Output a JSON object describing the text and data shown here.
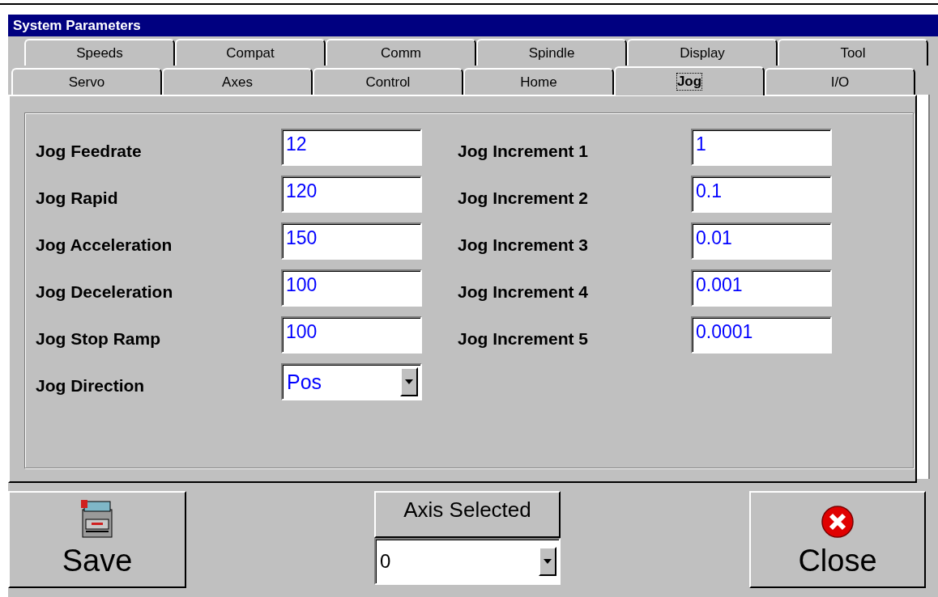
{
  "window": {
    "title": "System Parameters"
  },
  "tab_rows": [
    [
      {
        "label": "Speeds",
        "selected": false
      },
      {
        "label": "Compat",
        "selected": false
      },
      {
        "label": "Comm",
        "selected": false
      },
      {
        "label": "Spindle",
        "selected": false
      },
      {
        "label": "Display",
        "selected": false
      },
      {
        "label": "Tool",
        "selected": false
      }
    ],
    [
      {
        "label": "Servo",
        "selected": false
      },
      {
        "label": "Axes",
        "selected": false
      },
      {
        "label": "Control",
        "selected": false
      },
      {
        "label": "Home",
        "selected": false
      },
      {
        "label": "Jog",
        "selected": true
      },
      {
        "label": "I/O",
        "selected": false
      }
    ]
  ],
  "left_fields": [
    {
      "kind": "text",
      "label": "Jog Feedrate",
      "value": "12"
    },
    {
      "kind": "text",
      "label": "Jog Rapid",
      "value": "120"
    },
    {
      "kind": "text",
      "label": "Jog Acceleration",
      "value": "150"
    },
    {
      "kind": "text",
      "label": "Jog Deceleration",
      "value": "100"
    },
    {
      "kind": "text",
      "label": "Jog Stop Ramp",
      "value": "100"
    },
    {
      "kind": "combo",
      "label": "Jog Direction",
      "value": "Pos"
    }
  ],
  "right_fields": [
    {
      "kind": "text",
      "label": "Jog Increment 1",
      "value": "1"
    },
    {
      "kind": "text",
      "label": "Jog Increment 2",
      "value": "0.1"
    },
    {
      "kind": "text",
      "label": "Jog Increment 3",
      "value": "0.01"
    },
    {
      "kind": "text",
      "label": "Jog Increment 4",
      "value": "0.001"
    },
    {
      "kind": "text",
      "label": "Jog Increment 5",
      "value": "0.0001"
    }
  ],
  "save_button": {
    "label": "Save"
  },
  "axis_selected": {
    "label": "Axis Selected",
    "value": "0"
  },
  "close_button": {
    "label": "Close"
  }
}
